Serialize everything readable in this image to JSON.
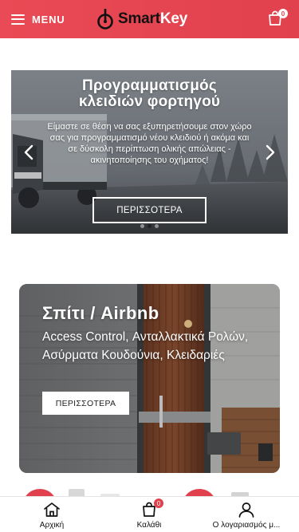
{
  "header": {
    "menu_label": "MENU",
    "logo_text_1": "Smart",
    "logo_text_2": "Key",
    "cart_count": "0"
  },
  "slider": {
    "title": "Προγραμματισμός\nκλειδιών φορτηγού",
    "text": "Είμαστε σε θέση να σας εξυπηρετήσουμε στον χώρο σας για προγραμματισμό νέου κλειδιού ή ακόμα και σε δύσκολη περίπτωση ολικής απώλειας - ακινητοποίησης του οχήματος!",
    "button_label": "ΠΕΡΙΣΣΟΤΕΡΑ",
    "slides_count": 3,
    "active_slide": 2
  },
  "card": {
    "title": "Σπίτι / Airbnb",
    "text": "Access Control, Ανταλλακτικά Ρολών, Ασύρματα Κουδούνια, Κλειδαριές",
    "button_label": "ΠΕΡΙΣΣΟΤΕΡΑ"
  },
  "bottom_nav": {
    "items": [
      {
        "label": "Αρχική",
        "icon": "home-icon"
      },
      {
        "label": "Καλάθι",
        "icon": "cart-icon",
        "badge": "0"
      },
      {
        "label": "Ο λογαριασμός μ...",
        "icon": "user-icon"
      }
    ]
  },
  "colors": {
    "brand_red": "#e0414d",
    "header_gradient_start": "#e94a55"
  }
}
